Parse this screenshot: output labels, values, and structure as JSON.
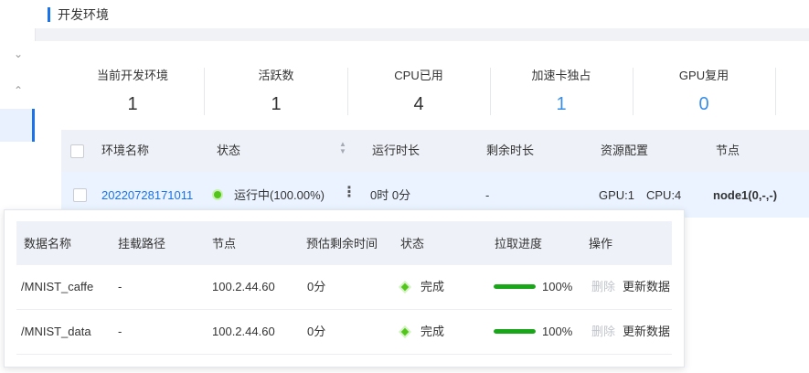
{
  "header": {
    "title": "开发环境"
  },
  "sidebar": {
    "chevrons": [
      "⌄",
      "⌃"
    ]
  },
  "stats": [
    {
      "label": "当前开发环境",
      "value": "1",
      "highlight": false
    },
    {
      "label": "活跃数",
      "value": "1",
      "highlight": false
    },
    {
      "label": "CPU已用",
      "value": "4",
      "highlight": false
    },
    {
      "label": "加速卡独占",
      "value": "1",
      "highlight": true
    },
    {
      "label": "GPU复用",
      "value": "0",
      "highlight": true
    }
  ],
  "env_table": {
    "columns": [
      "环境名称",
      "状态",
      "运行时长",
      "剩余时长",
      "资源配置",
      "节点"
    ],
    "rows": [
      {
        "name": "20220728171011",
        "status": "运行中(100.00%)",
        "runtime": "0时 0分",
        "remaining": "-",
        "gpu": "GPU:1",
        "cpu": "CPU:4",
        "node": "node1(0,-,-)"
      }
    ]
  },
  "data_popup": {
    "columns": [
      "数据名称",
      "挂载路径",
      "节点",
      "预估剩余时间",
      "状态",
      "拉取进度",
      "操作"
    ],
    "rows": [
      {
        "name": "/MNIST_caffe",
        "mount": "-",
        "node": "100.2.44.60",
        "eta": "0分",
        "status": "完成",
        "progress": 1.0,
        "progress_label": "100%",
        "delete": "删除",
        "update": "更新数据"
      },
      {
        "name": "/MNIST_data",
        "mount": "-",
        "node": "100.2.44.60",
        "eta": "0分",
        "status": "完成",
        "progress": 1.0,
        "progress_label": "100%",
        "delete": "删除",
        "update": "更新数据"
      }
    ]
  },
  "colors": {
    "accent": "#1a73e8",
    "success": "#52c41a",
    "progress": "#19a619",
    "stat_blue": "#3a8ee6"
  }
}
